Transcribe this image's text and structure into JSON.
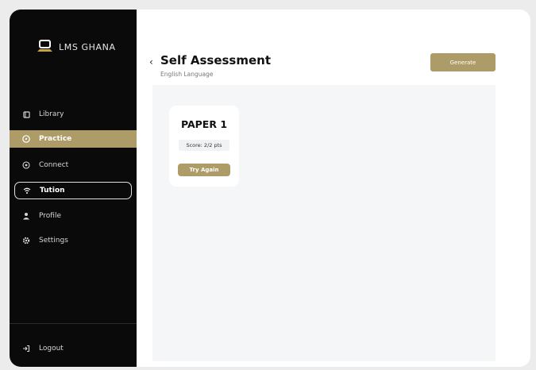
{
  "brand": {
    "name": "LMS GHANA",
    "accent": "#ae9c68",
    "sidebar_bg": "#0a0a0a"
  },
  "sidebar": {
    "items": [
      {
        "label": "Library",
        "icon": "book-icon",
        "state": "normal"
      },
      {
        "label": "Practice",
        "icon": "compass-icon",
        "state": "active"
      },
      {
        "label": "Connect",
        "icon": "target-icon",
        "state": "normal"
      },
      {
        "label": "Tution",
        "icon": "wifi-icon",
        "state": "outlined"
      },
      {
        "label": "Profile",
        "icon": "user-icon",
        "state": "normal"
      },
      {
        "label": "Settings",
        "icon": "gear-icon",
        "state": "normal"
      }
    ],
    "logout": {
      "label": "Logout",
      "icon": "logout-icon"
    }
  },
  "header": {
    "back_icon": "chevron-left-icon",
    "title": "Self Assessment",
    "subtitle": "English Language",
    "generate_label": "Generate"
  },
  "cards": [
    {
      "title": "PAPER 1",
      "score": "Score: 2/2 pts",
      "action_label": "Try Again"
    }
  ]
}
